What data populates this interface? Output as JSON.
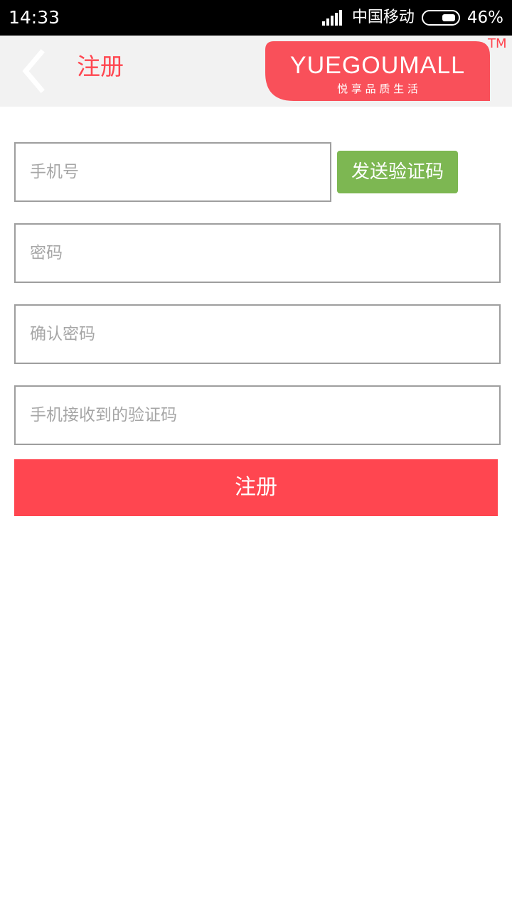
{
  "status_bar": {
    "time": "14:33",
    "carrier": "中国移动",
    "battery": "46%",
    "battery_level": 0.46
  },
  "header": {
    "title": "注册",
    "logo": {
      "brand": "YUEGOUMALL",
      "slogan": "悦 享 品 质 生 活",
      "trademark": "TM",
      "color": "#f9505a"
    }
  },
  "form": {
    "phone_placeholder": "手机号",
    "send_code_label": "发送验证码",
    "password_placeholder": "密码",
    "confirm_password_placeholder": "确认密码",
    "sms_code_placeholder": "手机接收到的验证码",
    "submit_label": "注册"
  },
  "colors": {
    "accent": "#ff4650",
    "send_button": "#7db752",
    "header_bg": "#f2f2f2",
    "input_border": "#9e9e9e"
  }
}
